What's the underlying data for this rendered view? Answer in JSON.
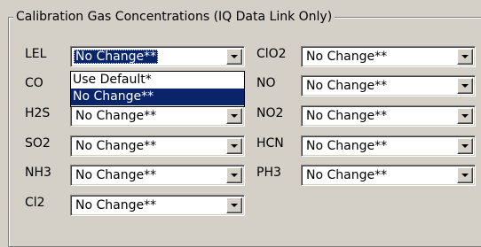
{
  "groupbox": {
    "title": "Calibration Gas Concentrations (IQ Data Link Only)"
  },
  "gases": [
    {
      "label": "LEL",
      "value": "No Change**"
    },
    {
      "label": "ClO2",
      "value": "No Change**"
    },
    {
      "label": "CO",
      "value": "No Change**"
    },
    {
      "label": "NO",
      "value": "No Change**"
    },
    {
      "label": "H2S",
      "value": "No Change**"
    },
    {
      "label": "NO2",
      "value": "No Change**"
    },
    {
      "label": "SO2",
      "value": "No Change**"
    },
    {
      "label": "HCN",
      "value": "No Change**"
    },
    {
      "label": "NH3",
      "value": "No Change**"
    },
    {
      "label": "PH3",
      "value": "No Change**"
    },
    {
      "label": "Cl2",
      "value": "No Change**"
    }
  ],
  "dropdown": {
    "open_for": "LEL",
    "options": [
      "Use Default*",
      "No Change**"
    ],
    "selected": "No Change**"
  },
  "colors": {
    "face": "#d4d0c8",
    "highlight": "#0a246a"
  },
  "icons": {
    "combo_button": "chevron-down-icon"
  }
}
